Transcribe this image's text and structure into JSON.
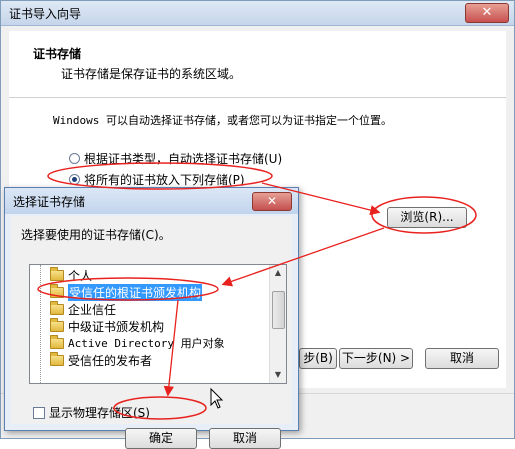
{
  "wizard": {
    "title": "证书导入向导",
    "close_glyph": "✕",
    "section_title": "证书存储",
    "section_desc": "证书存储是保存证书的系统区域。",
    "info_text": "Windows 可以自动选择证书存储，或者您可以为证书指定一个位置。",
    "radio_auto_label": "根据证书类型，自动选择证书存储(U)",
    "radio_manual_label": "将所有的证书放入下列存储(P)",
    "browse_label": "浏览(R)...",
    "back_label": "步(B)",
    "next_label": "下一步(N) >",
    "cancel_label": "取消"
  },
  "dialog": {
    "title": "选择证书存储",
    "close_glyph": "✕",
    "prompt": "选择要使用的证书存储(C)。",
    "stores": [
      {
        "label": "个人"
      },
      {
        "label": "受信任的根证书颁发机构"
      },
      {
        "label": "企业信任"
      },
      {
        "label": "中级证书颁发机构"
      },
      {
        "label": "Active Directory 用户对象"
      },
      {
        "label": "受信任的发布者"
      }
    ],
    "show_physical_label": "显示物理存储区(S)",
    "ok_label": "确定",
    "cancel_label": "取消"
  },
  "icons": {
    "folder": "folder-icon",
    "scroll_up": "▲",
    "scroll_down": "▼"
  },
  "colors": {
    "annotation_red": "#e8221e",
    "selection_blue": "#3399ff"
  }
}
